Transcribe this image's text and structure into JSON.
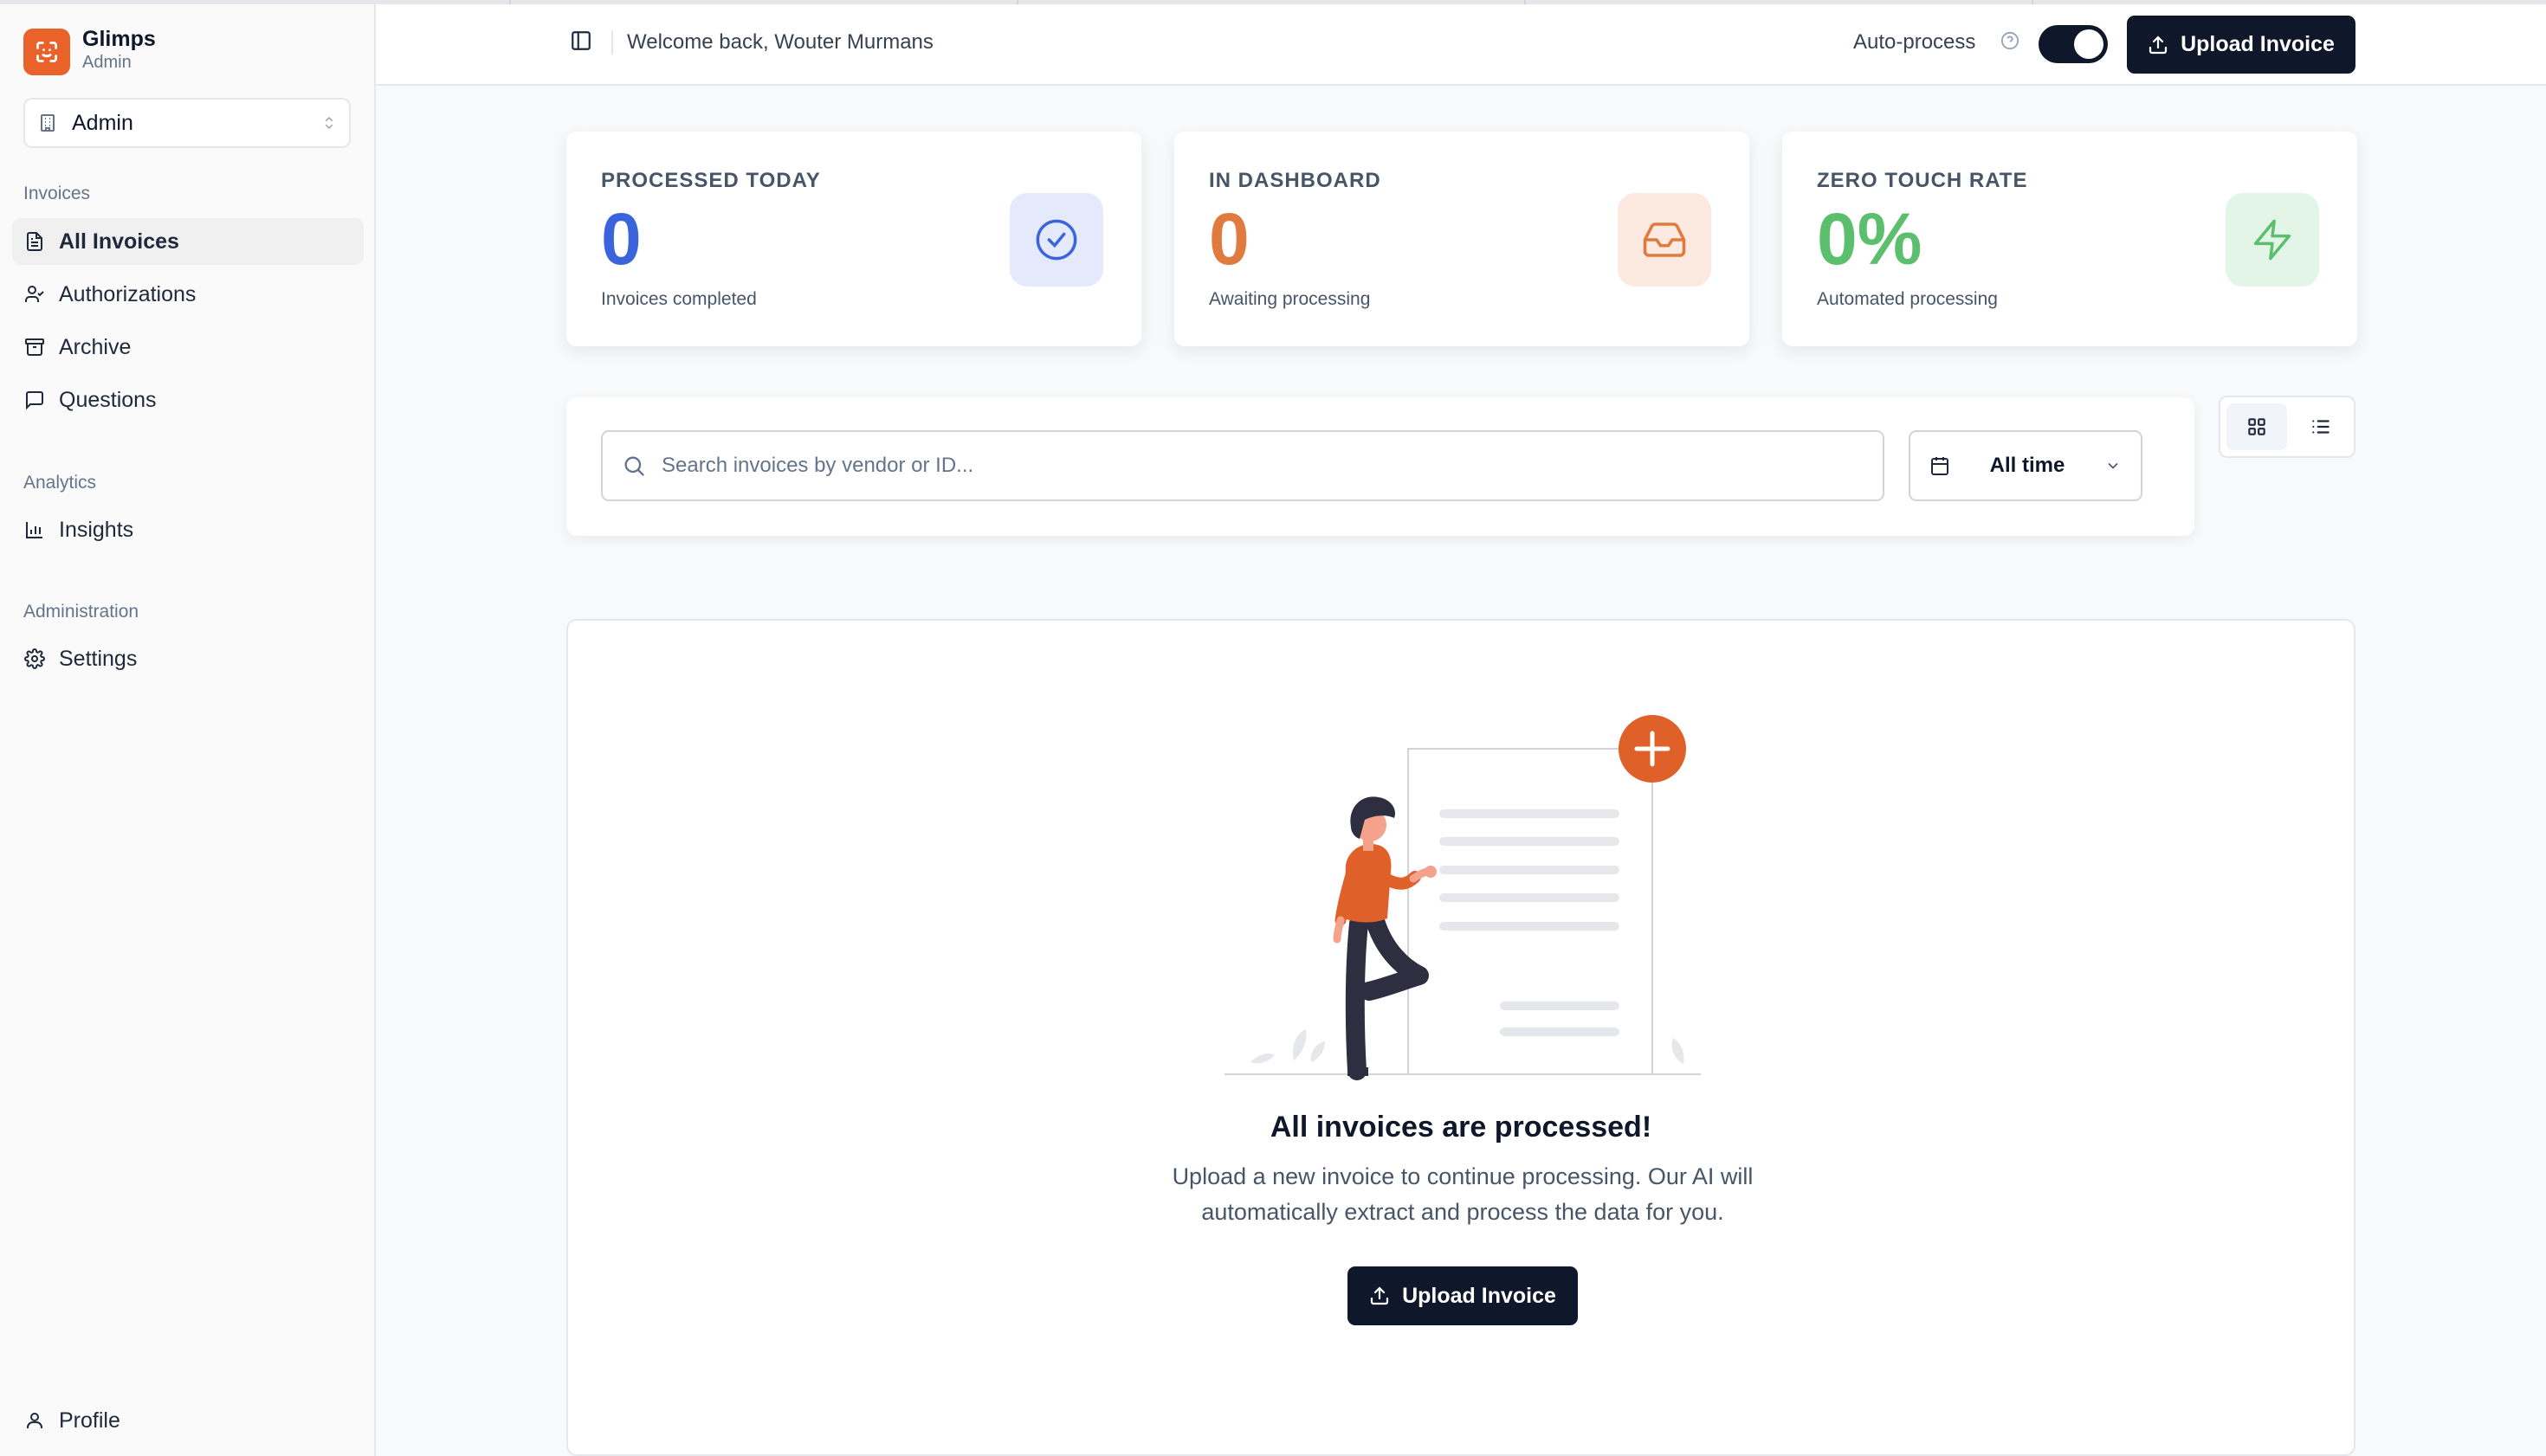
{
  "sidebar": {
    "brand_name": "Glimps",
    "brand_role": "Admin",
    "workspace": "Admin",
    "sections": {
      "invoices": "Invoices",
      "analytics": "Analytics",
      "administration": "Administration"
    },
    "items": {
      "all_invoices": "All Invoices",
      "authorizations": "Authorizations",
      "archive": "Archive",
      "questions": "Questions",
      "insights": "Insights",
      "settings": "Settings",
      "profile": "Profile"
    }
  },
  "header": {
    "welcome": "Welcome back, Wouter Murmans",
    "auto_process_label": "Auto-process",
    "auto_process_on": true,
    "upload_label": "Upload Invoice"
  },
  "stats": [
    {
      "title": "PROCESSED TODAY",
      "value": "0",
      "subtitle": "Invoices completed",
      "color": "#3b63db",
      "icon": "check-circle-icon"
    },
    {
      "title": "IN DASHBOARD",
      "value": "0",
      "subtitle": "Awaiting processing",
      "color": "#e07a3f",
      "icon": "inbox-icon"
    },
    {
      "title": "ZERO TOUCH RATE",
      "value": "0%",
      "subtitle": "Automated processing",
      "color": "#5bbf6e",
      "icon": "zap-icon"
    }
  ],
  "filters": {
    "search_placeholder": "Search invoices by vendor or ID...",
    "date_range": "All time"
  },
  "empty_state": {
    "title": "All invoices are processed!",
    "description": "Upload a new invoice to continue processing. Our AI will automatically extract and process the data for you.",
    "button_label": "Upload Invoice"
  },
  "colors": {
    "brand": "#e8622a",
    "dark": "#0f172a",
    "blue": "#3b63db",
    "orange": "#e07a3f",
    "green": "#5bbf6e"
  }
}
